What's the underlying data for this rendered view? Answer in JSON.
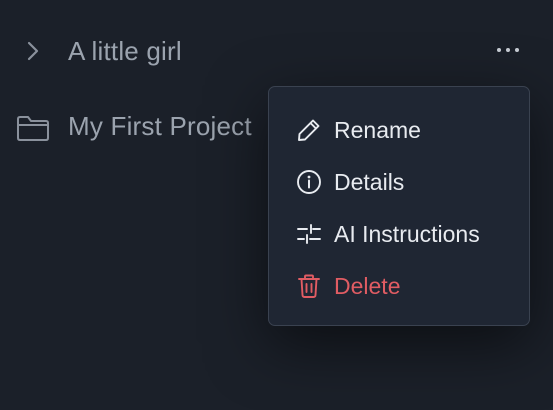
{
  "tree": {
    "items": [
      {
        "label": "A little girl",
        "icon": "chevron-right-icon"
      },
      {
        "label": "My First Project",
        "icon": "folder-icon"
      }
    ],
    "more_icon": "more-horizontal-icon"
  },
  "context_menu": {
    "items": [
      {
        "label": "Rename",
        "icon": "pencil-icon"
      },
      {
        "label": "Details",
        "icon": "info-icon"
      },
      {
        "label": "AI Instructions",
        "icon": "sliders-icon"
      },
      {
        "label": "Delete",
        "icon": "trash-icon"
      }
    ]
  },
  "colors": {
    "background": "#1b2029",
    "menu_background": "#1f2633",
    "text": "#e8ebf0",
    "muted_text": "#9ba3ae",
    "danger": "#e05c63"
  }
}
